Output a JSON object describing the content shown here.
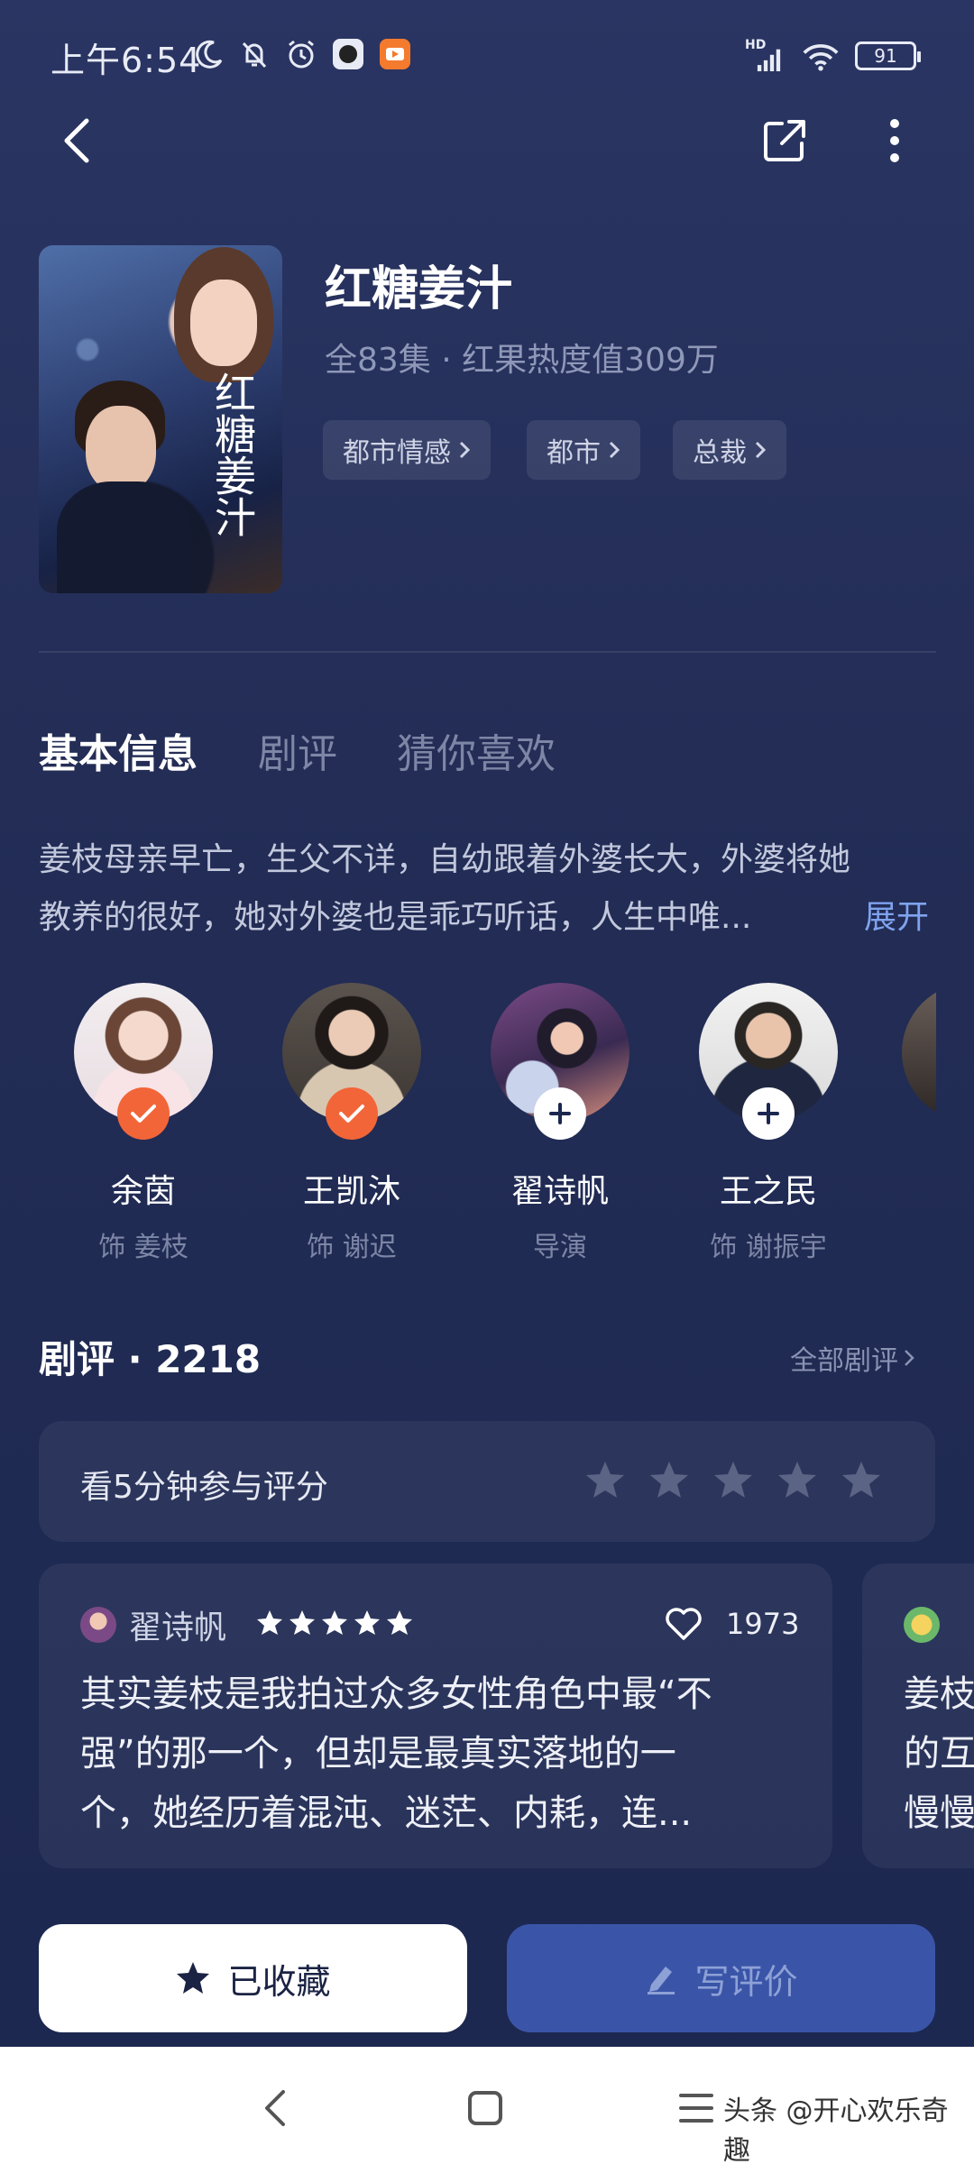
{
  "status_bar": {
    "time": "上午6:54",
    "network_label": "HD",
    "battery": "91"
  },
  "drama": {
    "title": "红糖姜汁",
    "meta": "全83集 · 红果热度值309万",
    "tags": [
      "都市情感",
      "都市",
      "总裁"
    ]
  },
  "tabs": [
    "基本信息",
    "剧评",
    "猜你喜欢"
  ],
  "synopsis": {
    "line1": "姜枝母亲早亡，生父不详，自幼跟着外婆长大，外婆将她",
    "line2": "教养的很好，她对外婆也是乖巧听话，人生中唯...",
    "expand": "展开"
  },
  "cast": [
    {
      "name": "余茵",
      "role": "饰 姜枝",
      "status": "followed"
    },
    {
      "name": "王凯沐",
      "role": "饰 谢迟",
      "status": "followed"
    },
    {
      "name": "翟诗帆",
      "role": "导演",
      "status": "add"
    },
    {
      "name": "王之民",
      "role": "饰 谢振宇",
      "status": "add"
    }
  ],
  "reviews_section": {
    "title": "剧评 · 2218",
    "all_link": "全部剧评"
  },
  "rate_card": {
    "prompt": "看5分钟参与评分"
  },
  "review": {
    "author": "翟诗帆",
    "rating": 5,
    "likes": "1973",
    "line1": "其实姜枝是我拍过众多女性角色中最“不",
    "line2": "强”的那一个，但却是最真实落地的一",
    "line3": "个，她经历着混沌、迷茫、内耗，连..."
  },
  "review_peek": {
    "line1": "姜枝",
    "line2": "的互",
    "line3": "慢慢"
  },
  "actions": {
    "favorite_label": "已收藏",
    "write_review_label": "写评价"
  },
  "watermark": "头条 @开心欢乐奇趣",
  "colors": {
    "background": "#232d56",
    "accent_orange": "#f26538",
    "link_blue": "#7fa3ee",
    "button_blue": "#3a55a8"
  }
}
